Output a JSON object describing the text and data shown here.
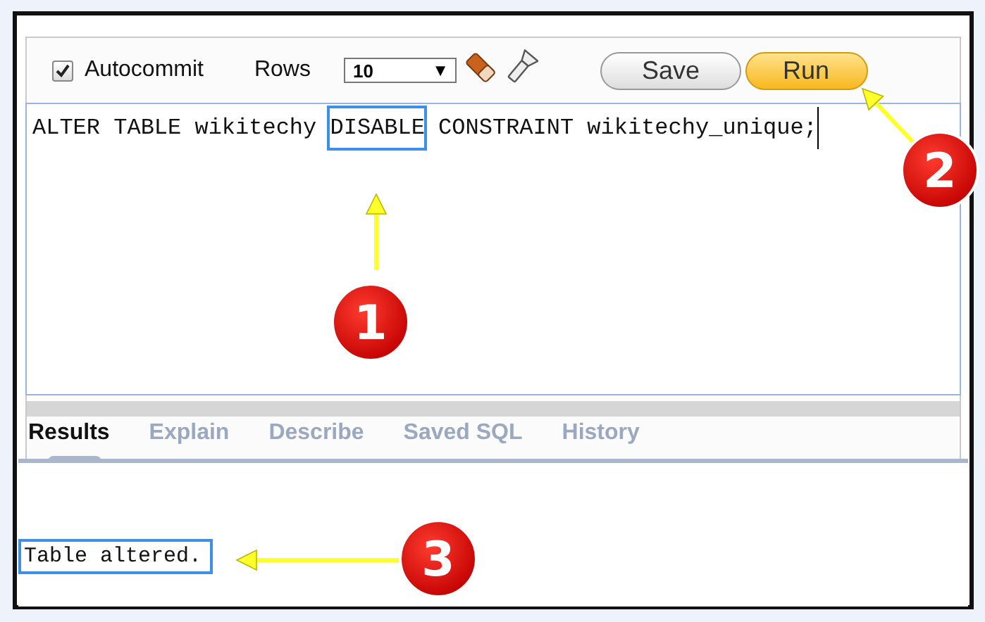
{
  "toolbar": {
    "autocommit": {
      "label": "Autocommit",
      "checked": true
    },
    "rows_label": "Rows",
    "rows_value": "10",
    "rows_arrow": "▼",
    "buttons": [
      {
        "label": "Save",
        "kind": "plain"
      },
      {
        "label": "Run",
        "kind": "primary"
      }
    ]
  },
  "editor": {
    "sql_before": "ALTER TABLE wikitechy ",
    "sql_highlight": "DISABLE",
    "sql_after": " CONSTRAINT wikitechy_unique;"
  },
  "tabs": [
    {
      "label": "Results",
      "selected": true
    },
    {
      "label": "Explain",
      "selected": false
    },
    {
      "label": "Describe",
      "selected": false
    },
    {
      "label": "Saved SQL",
      "selected": false
    },
    {
      "label": "History",
      "selected": false
    }
  ],
  "result": {
    "message": "Table altered."
  },
  "callouts": [
    {
      "number": "1"
    },
    {
      "number": "2"
    },
    {
      "number": "3"
    }
  ]
}
